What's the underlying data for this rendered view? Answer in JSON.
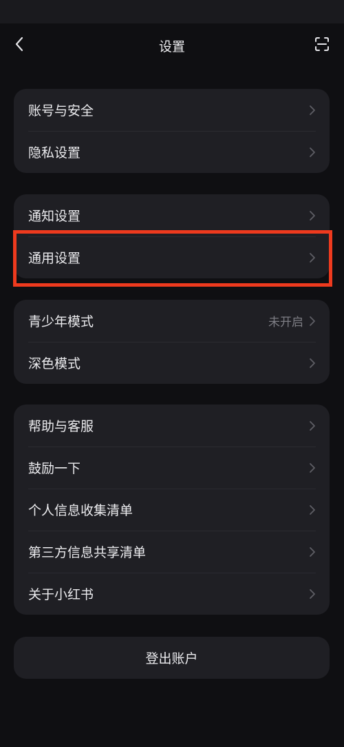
{
  "header": {
    "title": "设置",
    "back_icon": "chevron-left-icon",
    "scan_icon": "scan-icon"
  },
  "groups": [
    {
      "items": [
        {
          "label": "账号与安全"
        },
        {
          "label": "隐私设置"
        }
      ]
    },
    {
      "items": [
        {
          "label": "通知设置"
        },
        {
          "label": "通用设置",
          "highlighted": true
        }
      ]
    },
    {
      "items": [
        {
          "label": "青少年模式",
          "value": "未开启"
        },
        {
          "label": "深色模式"
        }
      ]
    },
    {
      "items": [
        {
          "label": "帮助与客服"
        },
        {
          "label": "鼓励一下"
        },
        {
          "label": "个人信息收集清单"
        },
        {
          "label": "第三方信息共享清单"
        },
        {
          "label": "关于小红书"
        }
      ]
    }
  ],
  "logout": {
    "label": "登出账户"
  },
  "colors": {
    "background": "#0f0f12",
    "card": "#1f1f24",
    "highlight": "#ee3a1e",
    "muted_text": "#7d7d84"
  }
}
